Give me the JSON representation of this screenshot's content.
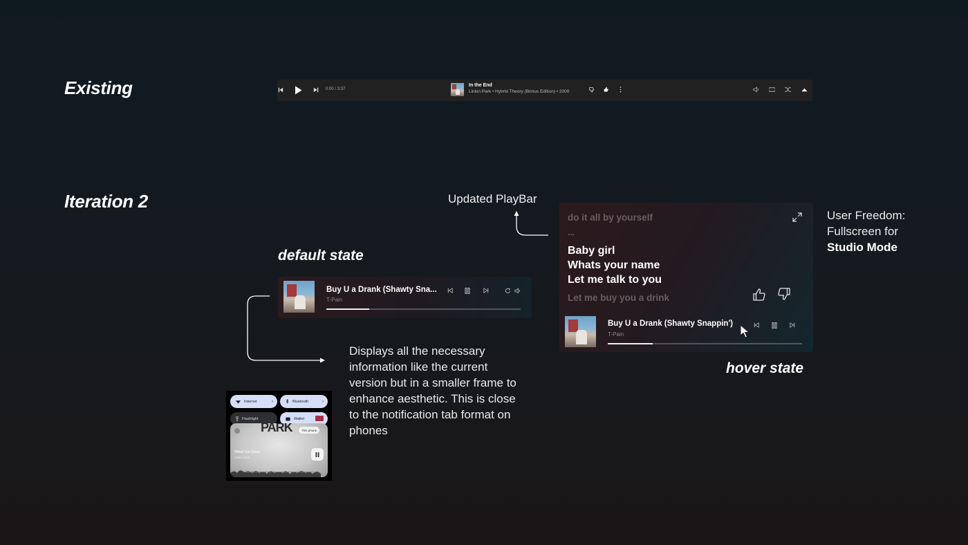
{
  "sections": {
    "existing_label": "Existing",
    "iteration_label": "Iteration 2"
  },
  "existing_bar": {
    "time": "0:00 / 3:37",
    "track_title": "In the End",
    "track_meta": "Linkin Park • Hybrid Theory (Bonus Edition) • 2000"
  },
  "annotations": {
    "updated_playbar": "Updated PlayBar",
    "default_state": "default state",
    "hover_state": "hover state",
    "user_freedom_line1": "User Freedom:",
    "user_freedom_line2": "Fullscreen for",
    "user_freedom_line3": "Studio Mode",
    "description": "Displays all the necessary information like the current version but in a smaller frame to enhance aesthetic. This is close to the notification tab format on phones"
  },
  "default_player": {
    "track_title": "Buy U a Drank (Shawty Sna...",
    "artist": "T-Pain",
    "progress": 0.22
  },
  "hover_player": {
    "lyrics_prev": "do it all by yourself",
    "lyrics_ellipsis": "...",
    "lyrics_current": [
      "Baby girl",
      "Whats your name",
      "Let me talk to you"
    ],
    "lyrics_next": "Let me buy you a drink",
    "track_title": "Buy U a Drank (Shawty Snappin')",
    "artist": "T-Pain",
    "progress": 0.23
  },
  "phone_panel": {
    "tiles": [
      "Internet",
      "Bluetooth",
      "Flashlight",
      "Wallet"
    ],
    "output_chip": "This phone",
    "track_title": "What I've Done",
    "artist": "Linkin Park",
    "album_text": "PARK"
  },
  "colors": {
    "background_top": "#0f1a20",
    "background_bottom": "#1a1617",
    "accent_tile": "#d6def7"
  }
}
